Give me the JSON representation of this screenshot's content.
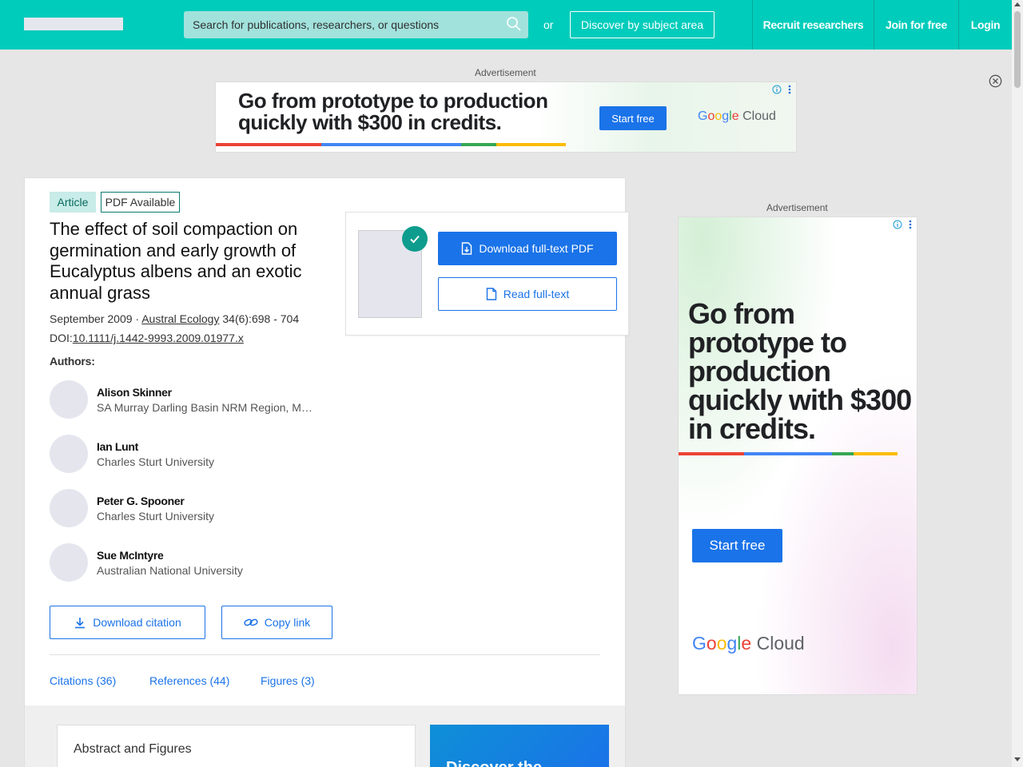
{
  "header": {
    "search_placeholder": "Search for publications, researchers, or questions",
    "or_text": "or",
    "discover_label": "Discover by subject area",
    "nav": {
      "recruit": "Recruit researchers",
      "join": "Join for free",
      "login": "Login"
    }
  },
  "ads": {
    "label": "Advertisement",
    "banner": {
      "headline_line1": "Go from prototype to production",
      "headline_line2": "quickly with $300 in credits.",
      "cta": "Start free",
      "brand_google": "Google",
      "brand_cloud": "Cloud"
    },
    "side": {
      "headline": "Go from prototype to production quickly with $300 in credits.",
      "cta": "Start free",
      "brand_google": "Google",
      "brand_cloud": "Cloud"
    },
    "bar_colors": [
      "#ea4335",
      "#4285f4",
      "#34a853",
      "#fbbc05"
    ]
  },
  "publication": {
    "type_badge": "Article",
    "pdf_badge": "PDF Available",
    "title": "The effect of soil compaction on germination and early growth of Eucalyptus albens and an exotic annual grass",
    "date": "September 2009",
    "separator": " · ",
    "journal": "Austral Ecology",
    "volume_pages": " 34(6):698 - 704",
    "doi_label": "DOI:",
    "doi": "10.1111/j.1442-9993.2009.01977.x",
    "authors_label": "Authors:",
    "authors": [
      {
        "name": "Alison Skinner",
        "affiliation": "SA Murray Darling Basin NRM Region, Murray Bridge"
      },
      {
        "name": "Ian Lunt",
        "affiliation": "Charles Sturt University"
      },
      {
        "name": "Peter G. Spooner",
        "affiliation": "Charles Sturt University"
      },
      {
        "name": "Sue McIntyre",
        "affiliation": "Australian National University"
      }
    ],
    "download_citation": "Download citation",
    "copy_link": "Copy link",
    "tabs": {
      "citations": "Citations (36)",
      "references": "References (44)",
      "figures": "Figures (3)"
    },
    "abstract_title": "Abstract and Figures",
    "discover_card_title": "Discover the"
  },
  "pdf_panel": {
    "download_pdf": "Download full-text PDF",
    "read_fulltext": "Read full-text"
  },
  "colors": {
    "brand": "#00ccbb",
    "accent_blue": "#1a73e8",
    "badge_bg": "#c8ece8",
    "check_green": "#0d9c8d"
  }
}
